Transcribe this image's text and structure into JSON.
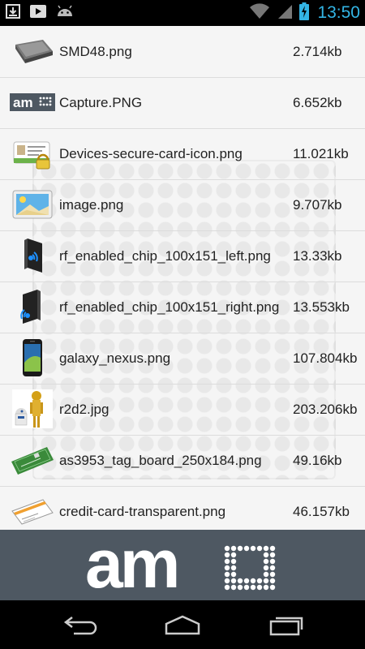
{
  "status_bar": {
    "time": "13:50",
    "icons": [
      "download-icon",
      "play-store-icon",
      "android-icon",
      "wifi-icon",
      "signal-icon",
      "battery-charging-icon"
    ]
  },
  "files": [
    {
      "name": "SMD48.png",
      "size": "2.714kb",
      "icon": "chip-thumbnail"
    },
    {
      "name": "Capture.PNG",
      "size": "6.652kb",
      "icon": "ams-logo-thumbnail"
    },
    {
      "name": "Devices-secure-card-icon.png",
      "size": "11.021kb",
      "icon": "secure-card-thumbnail"
    },
    {
      "name": "image.png",
      "size": "9.707kb",
      "icon": "image-thumbnail"
    },
    {
      "name": "rf_enabled_chip_100x151_left.png",
      "size": "13.33kb",
      "icon": "rf-chip-left-thumbnail"
    },
    {
      "name": "rf_enabled_chip_100x151_right.png",
      "size": "13.553kb",
      "icon": "rf-chip-right-thumbnail"
    },
    {
      "name": "galaxy_nexus.png",
      "size": "107.804kb",
      "icon": "phone-thumbnail"
    },
    {
      "name": "r2d2.jpg",
      "size": "203.206kb",
      "icon": "robots-thumbnail"
    },
    {
      "name": "as3953_tag_board_250x184.png",
      "size": "49.16kb",
      "icon": "tag-board-thumbnail"
    },
    {
      "name": "credit-card-transparent.png",
      "size": "46.157kb",
      "icon": "credit-card-thumbnail"
    }
  ],
  "brand": {
    "logo_text": "am",
    "logo_dotted": "u",
    "name": "ams"
  },
  "nav": {
    "icons": [
      "back-icon",
      "home-icon",
      "recent-apps-icon"
    ]
  },
  "colors": {
    "time": "#33b5e5",
    "brand_bg": "#4e5862",
    "divider": "#dcdcdc"
  }
}
